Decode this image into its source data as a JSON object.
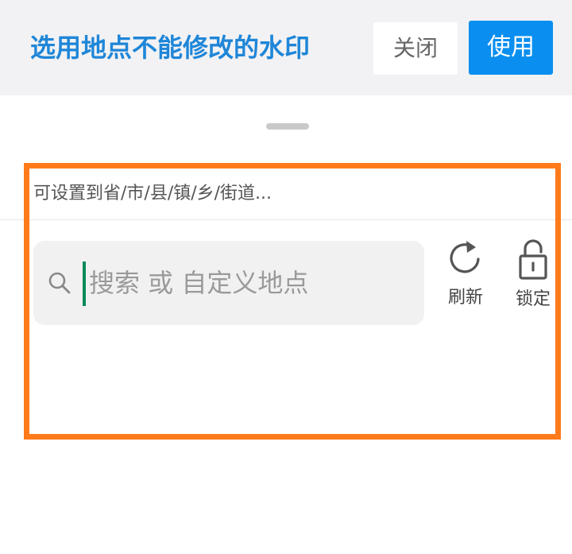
{
  "header": {
    "title": "选用地点不能修改的水印",
    "close_label": "关闭",
    "use_label": "使用"
  },
  "panel": {
    "hint": "可设置到省/市/县/镇/乡/街道...",
    "search_placeholder": "搜索 或 自定义地点",
    "refresh_label": "刷新",
    "lock_label": "锁定"
  },
  "colors": {
    "title_blue": "#1f86d8",
    "use_button": "#0a8ff0",
    "highlight_orange": "#ff7a1a"
  },
  "icons": [
    "search-icon",
    "refresh-icon",
    "unlock-icon"
  ]
}
